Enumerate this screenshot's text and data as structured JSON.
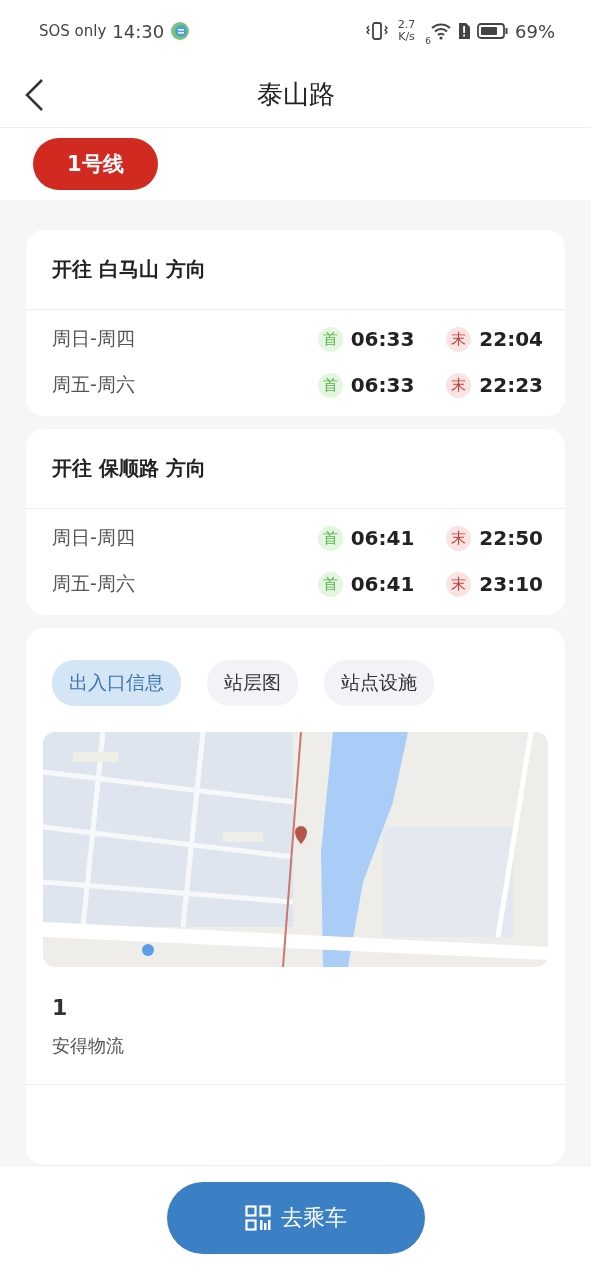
{
  "status_bar": {
    "carrier": "SOS only",
    "time": "14:30",
    "speed_value": "2.7",
    "speed_unit": "K/s",
    "wifi_generation": "6",
    "battery": "69%"
  },
  "header": {
    "title": "泰山路"
  },
  "line_badge": {
    "label": "1号线"
  },
  "directions": [
    {
      "title": "开往 白马山 方向",
      "schedules": [
        {
          "days": "周日-周四",
          "first_label": "首",
          "first": "06:33",
          "last_label": "末",
          "last": "22:04"
        },
        {
          "days": "周五-周六",
          "first_label": "首",
          "first": "06:33",
          "last_label": "末",
          "last": "22:23"
        }
      ]
    },
    {
      "title": "开往 保顺路 方向",
      "schedules": [
        {
          "days": "周日-周四",
          "first_label": "首",
          "first": "06:41",
          "last_label": "末",
          "last": "22:50"
        },
        {
          "days": "周五-周六",
          "first_label": "首",
          "first": "06:41",
          "last_label": "末",
          "last": "23:10"
        }
      ]
    }
  ],
  "tabs": [
    {
      "label": "出入口信息",
      "selected": true
    },
    {
      "label": "站层图",
      "selected": false
    },
    {
      "label": "站点设施",
      "selected": false
    }
  ],
  "exits": [
    {
      "number": "1",
      "name": "安得物流"
    }
  ],
  "ride_button": {
    "label": "去乘车"
  }
}
